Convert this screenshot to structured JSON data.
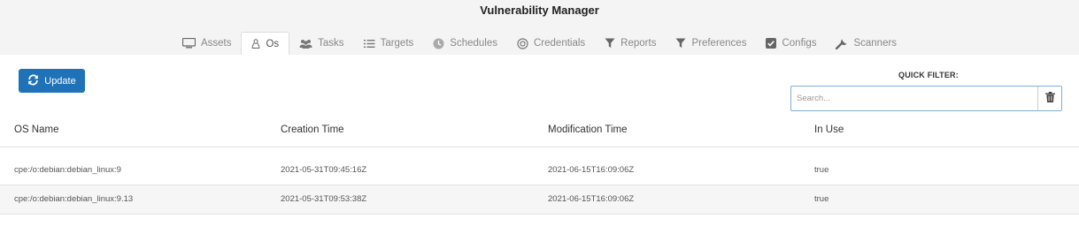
{
  "app": {
    "title": "Vulnerability Manager"
  },
  "tabs": [
    {
      "label": "Assets",
      "icon": "monitor-icon",
      "active": false
    },
    {
      "label": "Os",
      "icon": "linux-icon",
      "active": true
    },
    {
      "label": "Tasks",
      "icon": "users-icon",
      "active": false
    },
    {
      "label": "Targets",
      "icon": "list-icon",
      "active": false
    },
    {
      "label": "Schedules",
      "icon": "clock-icon",
      "active": false
    },
    {
      "label": "Credentials",
      "icon": "target-icon",
      "active": false
    },
    {
      "label": "Reports",
      "icon": "filter-icon",
      "active": false
    },
    {
      "label": "Preferences",
      "icon": "filter-icon",
      "active": false
    },
    {
      "label": "Configs",
      "icon": "checkbox-icon",
      "active": false
    },
    {
      "label": "Scanners",
      "icon": "wrench-icon",
      "active": false
    }
  ],
  "toolbar": {
    "update_label": "Update",
    "update_icon": "refresh-icon"
  },
  "quick_filter": {
    "label": "QUICK FILTER:",
    "placeholder": "Search...",
    "value": "",
    "clear_icon": "trash-icon"
  },
  "table": {
    "columns": [
      "OS Name",
      "Creation Time",
      "Modification Time",
      "In Use"
    ],
    "rows": [
      [
        "cpe:/o:debian:debian_linux:9",
        "2021-05-31T09:45:16Z",
        "2021-06-15T16:09:06Z",
        "true"
      ],
      [
        "cpe:/o:debian:debian_linux:9.13",
        "2021-05-31T09:53:38Z",
        "2021-06-15T16:09:06Z",
        "true"
      ]
    ]
  },
  "colors": {
    "primary": "#1f72b8",
    "search_border": "#7fb0d6",
    "tab_text": "#888888",
    "background": "#f4f4f4"
  }
}
